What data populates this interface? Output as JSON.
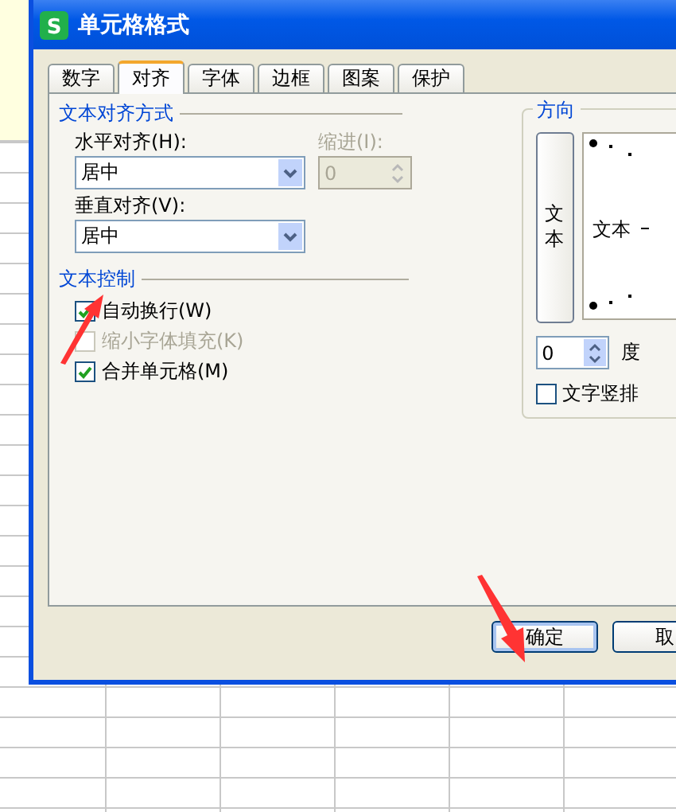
{
  "window": {
    "icon_letter": "S",
    "title": "单元格格式"
  },
  "tabs": [
    {
      "label": "数字",
      "selected": false
    },
    {
      "label": "对齐",
      "selected": true
    },
    {
      "label": "字体",
      "selected": false
    },
    {
      "label": "边框",
      "selected": false
    },
    {
      "label": "图案",
      "selected": false
    },
    {
      "label": "保护",
      "selected": false
    }
  ],
  "text_alignment": {
    "title": "文本对齐方式",
    "horizontal": {
      "label": "水平对齐(H):",
      "value": "居中"
    },
    "indent": {
      "label": "缩进(I):",
      "value": "0",
      "disabled": true
    },
    "vertical": {
      "label": "垂直对齐(V):",
      "value": "居中"
    }
  },
  "text_control": {
    "title": "文本控制",
    "options": [
      {
        "label": "自动换行(W)",
        "checked": true,
        "disabled": false
      },
      {
        "label": "缩小字体填充(K)",
        "checked": false,
        "disabled": true
      },
      {
        "label": "合并单元格(M)",
        "checked": true,
        "disabled": false
      }
    ]
  },
  "orientation": {
    "title": "方向",
    "vertical_text_button": "文本",
    "preview_text": "文本",
    "degrees": {
      "value": "0",
      "label": "度"
    },
    "vertical_text": {
      "label": "文字竖排",
      "checked": false
    }
  },
  "buttons": [
    {
      "label": "确定",
      "default": true
    },
    {
      "label": "取",
      "default": false
    }
  ]
}
